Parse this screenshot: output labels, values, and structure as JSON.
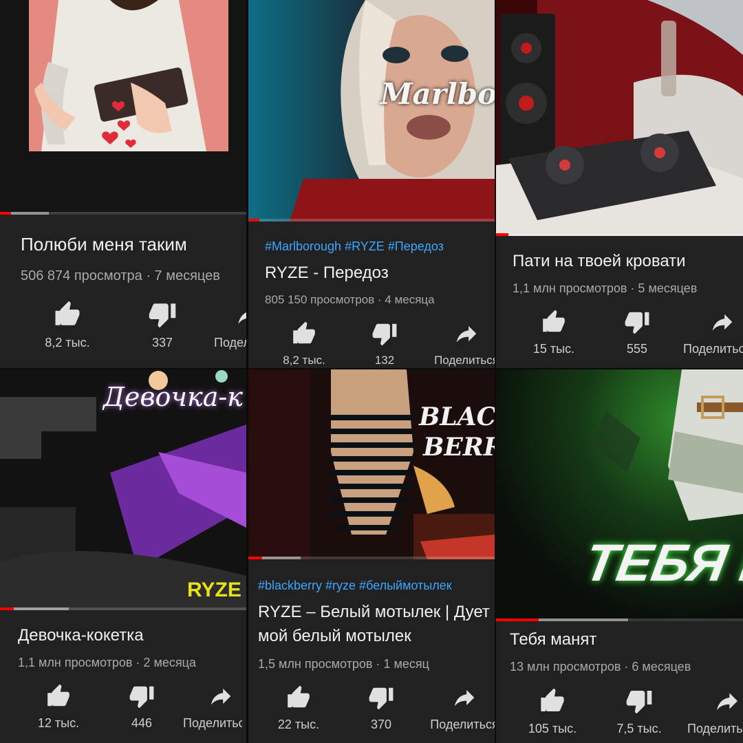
{
  "colors": {
    "accent": "#ff0000",
    "hashtag": "#3ea6ff",
    "card_bg": "#212121"
  },
  "videos": [
    {
      "title": "Полюби меня таким",
      "meta": "506 874 просмотра · 7 месяцев",
      "likes": "8,2 тыс.",
      "dislikes": "337",
      "share": "Поделиться",
      "progress": 0.05,
      "thumb_icons": [
        "heart-icon"
      ]
    },
    {
      "hashtags": "#Marlborough #RYZE #Передоз",
      "title": "RYZE - Передоз",
      "meta": "805 150 просмотров · 4 месяца",
      "likes": "8,2 тыс.",
      "dislikes": "132",
      "share": "Поделиться",
      "progress": 0.05,
      "thumb_text": "Marlboro"
    },
    {
      "title": "Пати на твоей кровати",
      "meta": "1,1 млн просмотров · 5 месяцев",
      "likes": "15 тыс.",
      "dislikes": "555",
      "share": "Поделиться",
      "progress": 0.05
    },
    {
      "title": "Девочка-кокетка",
      "meta": "1,1 млн просмотров · 2 месяца",
      "likes": "12 тыс.",
      "dislikes": "446",
      "share": "Поделиться",
      "progress": 0.06,
      "thumb_text": "Девочка-к",
      "thumb_brand": "RYZE"
    },
    {
      "hashtags": "#blackberry #ryze #белыймотылек",
      "title_line1": "RYZE – Белый мотылек | Дует",
      "title_line2": "мой белый мотылек",
      "meta": "1,5 млн просмотров · 1 месяц",
      "likes": "22 тыс.",
      "dislikes": "370",
      "share": "Поделиться",
      "progress": 0.06,
      "thumb_text_1": "BLAC",
      "thumb_text_2": "BERR"
    },
    {
      "title": "Тебя манят",
      "meta": "13 млн просмотров · 6 месяцев",
      "likes": "105 тыс.",
      "dislikes": "7,5 тыс.",
      "share": "Поделиться",
      "progress": 0.18,
      "thumb_text": "ТЕБЯ М"
    }
  ]
}
